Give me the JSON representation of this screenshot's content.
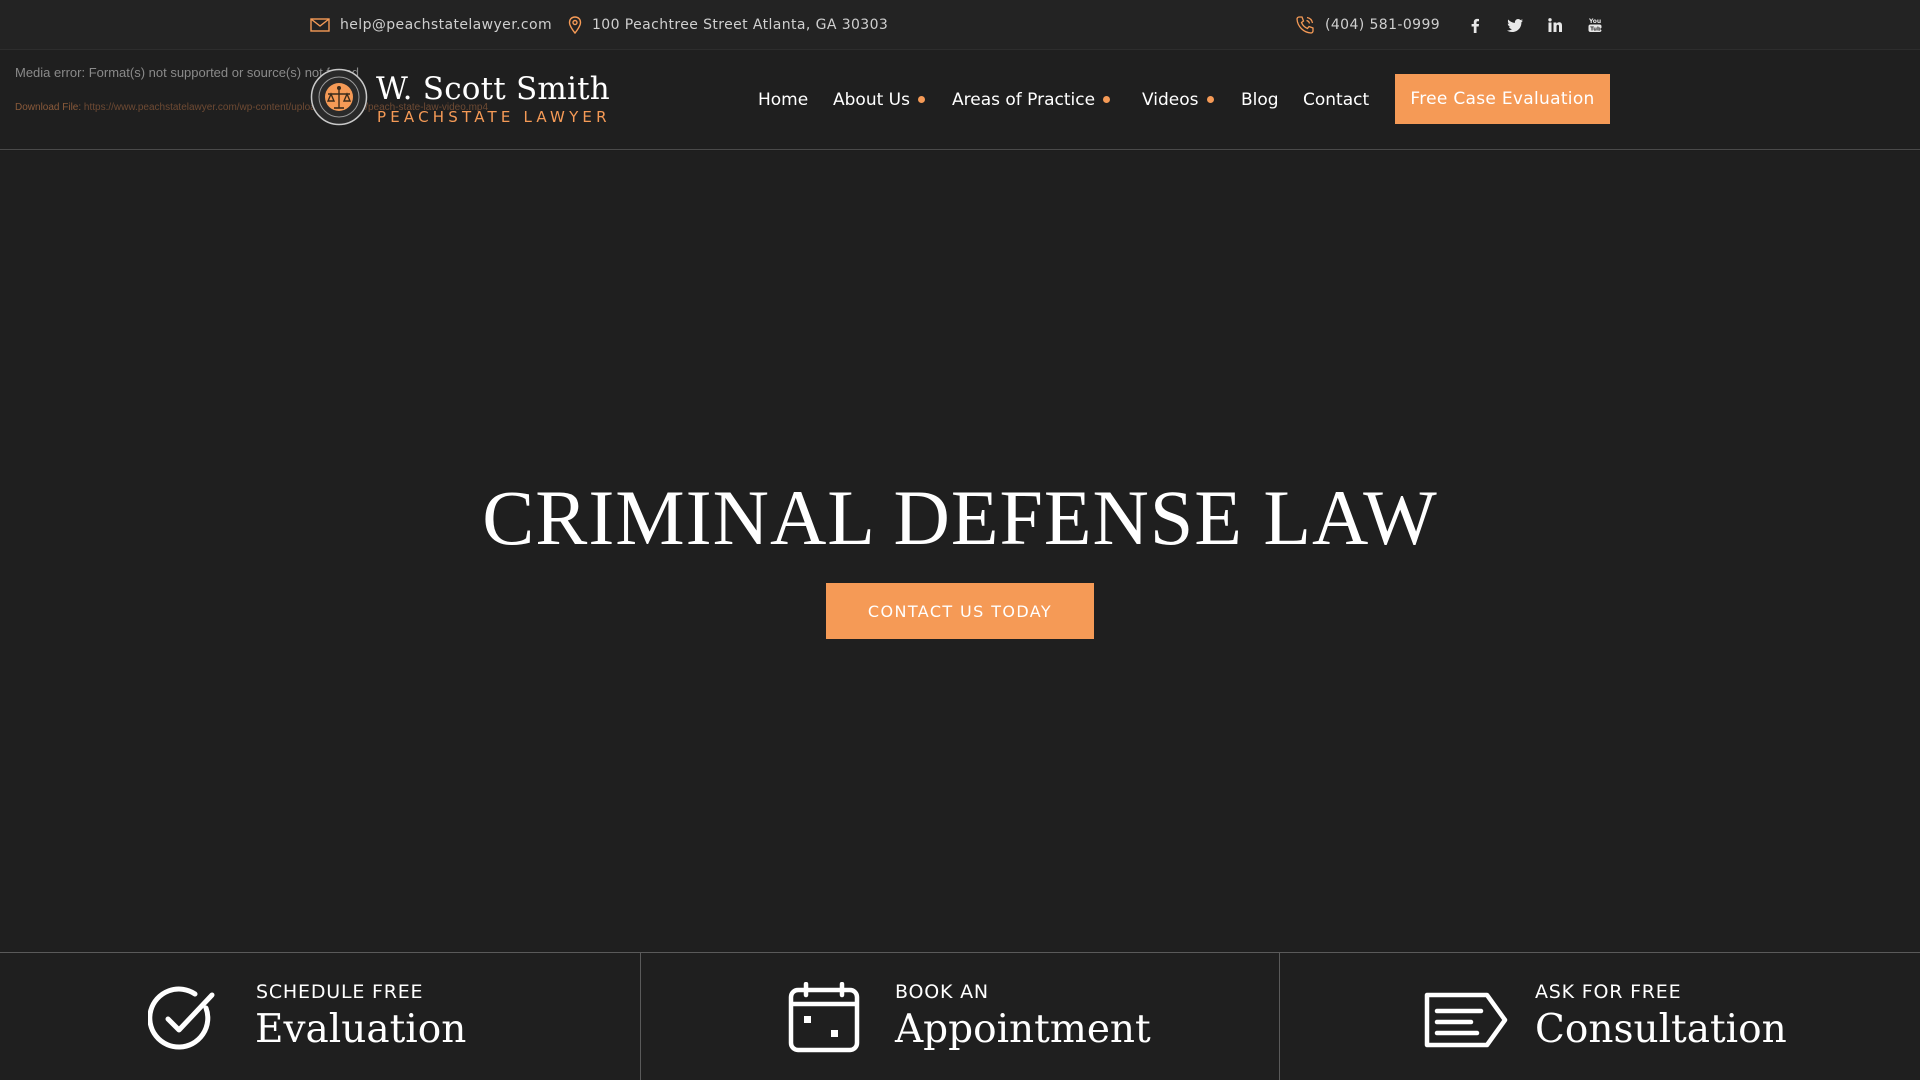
{
  "topbar": {
    "email": "help@peachstatelawyer.com",
    "address": "100 Peachtree Street Atlanta, GA 30303",
    "phone": "(404) 581-0999",
    "social": [
      {
        "name": "facebook-icon",
        "glyph": "f"
      },
      {
        "name": "twitter-icon",
        "glyph": "t"
      },
      {
        "name": "linkedin-icon",
        "glyph": "in"
      },
      {
        "name": "youtube-icon",
        "glyph": "yt"
      }
    ]
  },
  "media": {
    "error": "Media error: Format(s) not supported or source(s) not found",
    "download_label": "Download File: ",
    "download_url": "https://www.peachstatelawyer.com/wp-content/uploads/2020/09/peach-state-law-video.mp4"
  },
  "logo": {
    "name": "W. Scott Smith",
    "tagline": "PEACHSTATE LAWYER"
  },
  "nav": {
    "items": [
      {
        "label": "Home",
        "dropdown": false
      },
      {
        "label": "About Us",
        "dropdown": true
      },
      {
        "label": "Areas of Practice",
        "dropdown": true
      },
      {
        "label": "Videos",
        "dropdown": true
      },
      {
        "label": "Blog",
        "dropdown": false
      },
      {
        "label": "Contact",
        "dropdown": false
      }
    ],
    "cta": "Free Case Evaluation"
  },
  "hero": {
    "title": "CRIMINAL DEFENSE LAW",
    "button": "CONTACT US TODAY"
  },
  "features": [
    {
      "small": "SCHEDULE FREE",
      "big": "Evaluation",
      "icon": "check-circle-icon"
    },
    {
      "small": "BOOK AN",
      "big": "Appointment",
      "icon": "calendar-icon"
    },
    {
      "small": "ASK FOR FREE",
      "big": "Consultation",
      "icon": "message-icon"
    }
  ],
  "colors": {
    "accent": "#f59a56",
    "background": "#1f1f1f",
    "topbar": "#232323"
  }
}
